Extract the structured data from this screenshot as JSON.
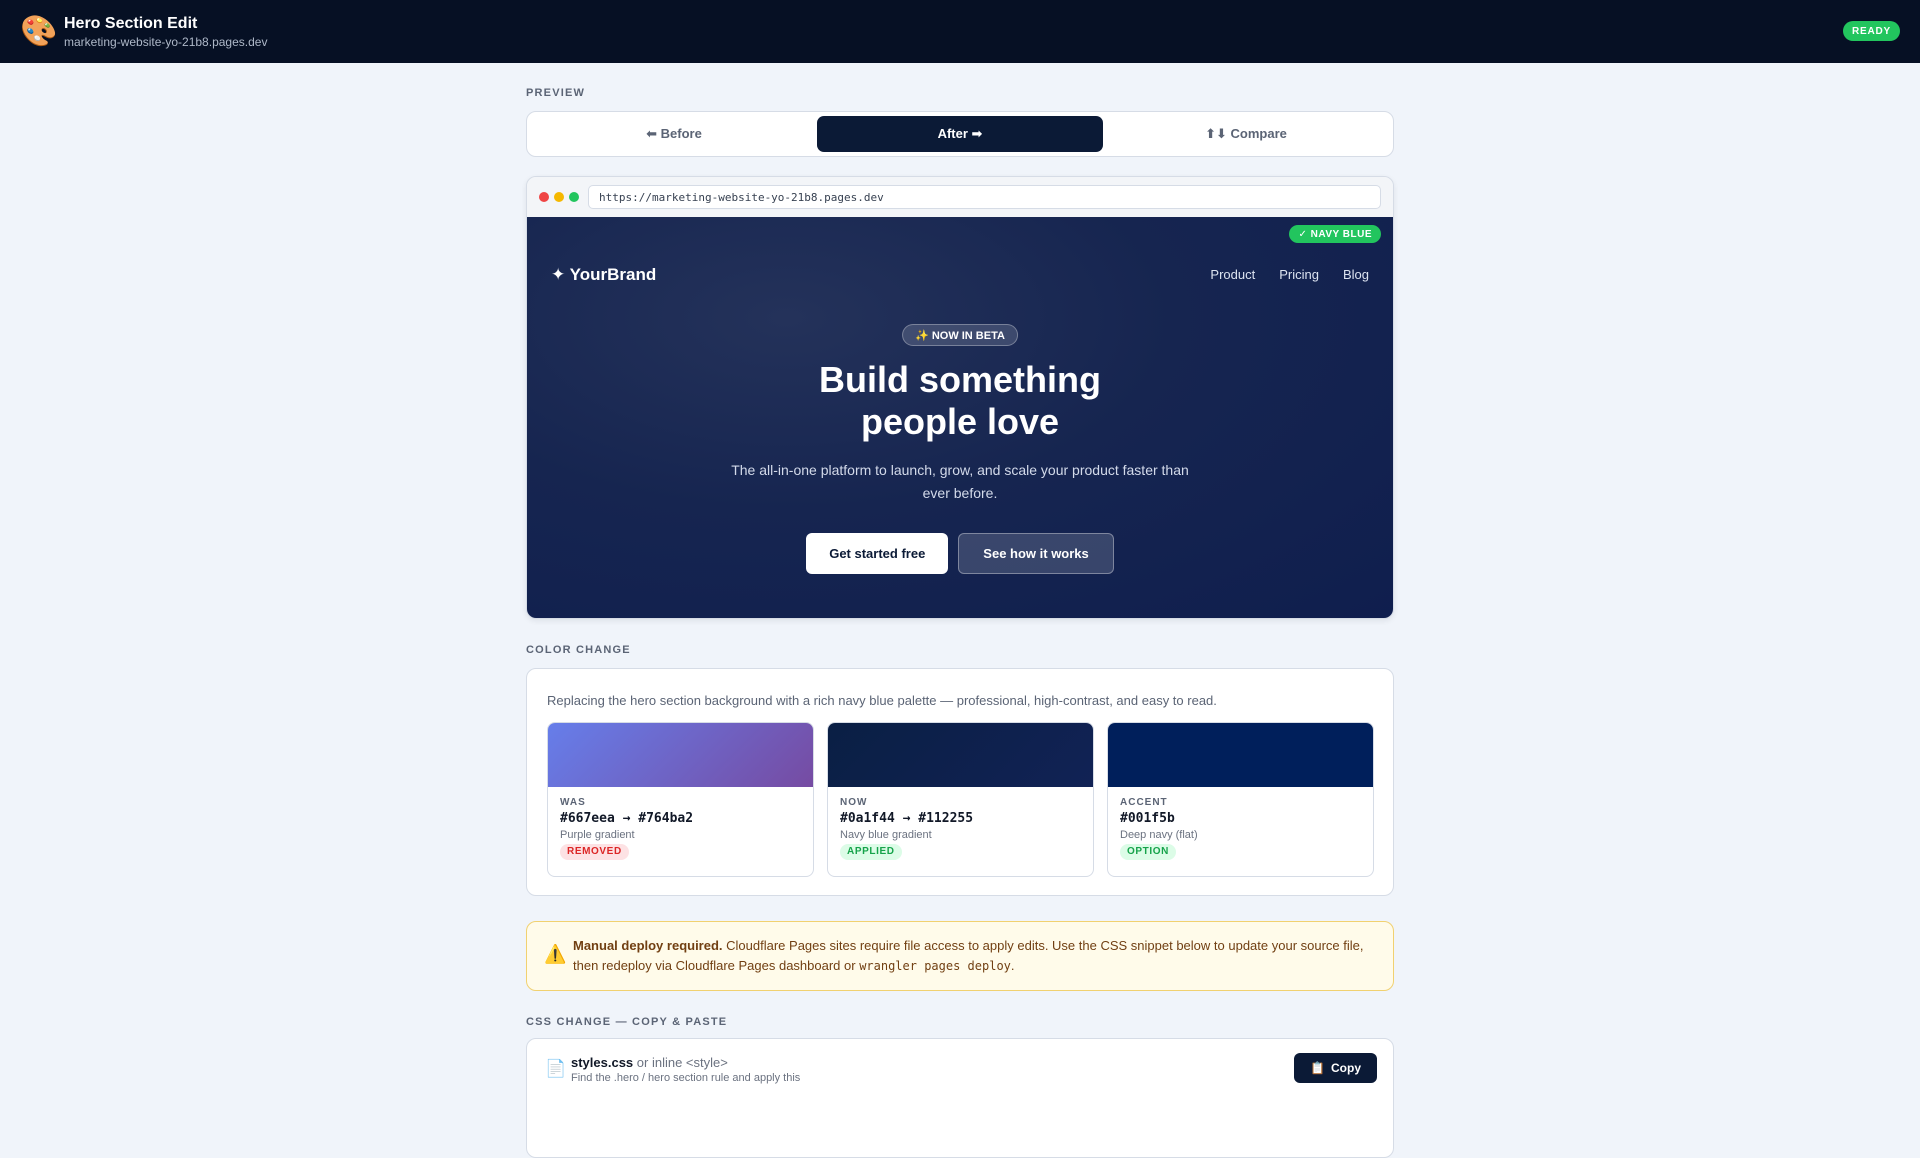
{
  "header": {
    "icon": "palette-icon",
    "title": "Hero Section Edit",
    "subtitle": "marketing-website-yo-21b8.pages.dev",
    "status": "READY"
  },
  "preview": {
    "label": "PREVIEW",
    "tabs": [
      {
        "label": "⬅ Before",
        "active": false
      },
      {
        "label": "After ➡",
        "active": true
      },
      {
        "label": "⬆⬇ Compare",
        "active": false
      }
    ],
    "url": "https://marketing-website-yo-21b8.pages.dev",
    "badge": "✓ NAVY BLUE",
    "brand": "✦ YourBrand",
    "nav": [
      "Product",
      "Pricing",
      "Blog"
    ],
    "beta": "✨ NOW IN BETA",
    "headline_1": "Build something",
    "headline_2": "people love",
    "description": "The all-in-one platform to launch, grow, and scale your product faster than ever before.",
    "primary_cta": "Get started free",
    "secondary_cta": "See how it works"
  },
  "color_change": {
    "label": "COLOR CHANGE",
    "intro": "Replacing the hero section background with a rich navy blue palette — professional, high-contrast, and easy to read.",
    "swatches": [
      {
        "label": "WAS",
        "hex": "#667eea → #764ba2",
        "note": "Purple gradient",
        "tag": "REMOVED",
        "colors": [
          "#667eea",
          "#764ba2"
        ]
      },
      {
        "label": "NOW",
        "hex": "#0a1f44 → #112255",
        "note": "Navy blue gradient",
        "tag": "APPLIED",
        "colors": [
          "#0a1f44",
          "#112255"
        ]
      },
      {
        "label": "ACCENT",
        "hex": "#001f5b",
        "note": "Deep navy (flat)",
        "tag": "OPTION",
        "colors": [
          "#001f5b"
        ]
      }
    ]
  },
  "alert": {
    "title": "Manual deploy required.",
    "body_1": "Cloudflare Pages sites require file access to apply edits. Use the CSS snippet below to update your source file, then redeploy via Cloudflare Pages dashboard or ",
    "code": "wrangler pages deploy",
    "body_2": "."
  },
  "css_change": {
    "label": "CSS CHANGE — COPY & PASTE",
    "file": "styles.css",
    "file_suffix": "or inline <style>",
    "hint": "Find the .hero / hero section rule and apply this",
    "copy_label": "Copy"
  },
  "colors": {
    "accent": "#0b1a36",
    "success": "#22c55e",
    "warning_bg": "#fffbea"
  }
}
